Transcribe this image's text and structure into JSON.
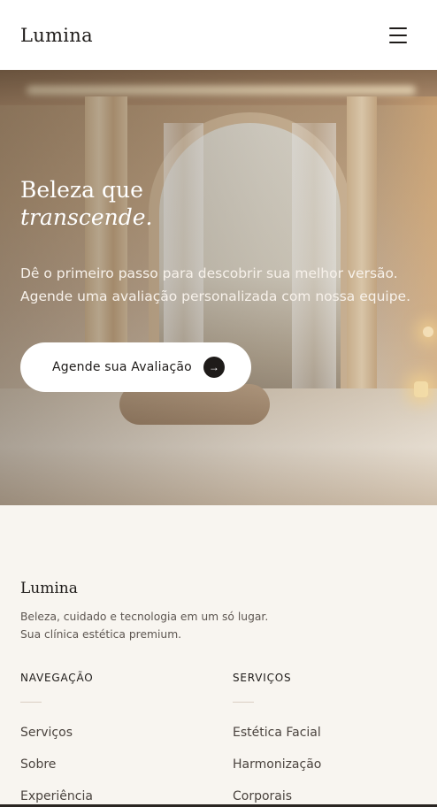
{
  "header": {
    "brand": "Lumina",
    "menu_icon": "hamburger-menu-icon"
  },
  "hero": {
    "title_line1": "Beleza que",
    "title_line2": "transcende.",
    "text": "Dê o primeiro passo para descobrir sua melhor versão. Agende uma avaliação personalizada com nossa equipe.",
    "cta_label": "Agende sua Avaliação",
    "cta_icon": "arrow-right-icon"
  },
  "footer": {
    "brand": "Lumina",
    "description": "Beleza, cuidado e tecnologia em um só lugar. Sua clínica estética premium.",
    "nav": {
      "heading": "NAVEGAÇÃO",
      "items": [
        "Serviços",
        "Sobre",
        "Experiência"
      ]
    },
    "services": {
      "heading": "SERVIÇOS",
      "items": [
        "Estética Facial",
        "Harmonização",
        "Corporais"
      ]
    }
  }
}
